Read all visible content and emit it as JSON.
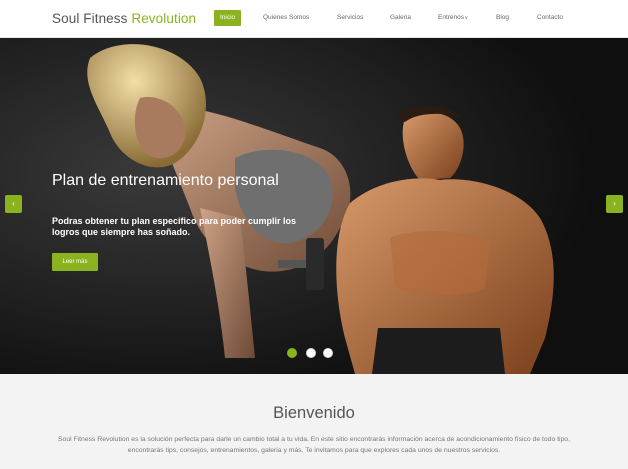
{
  "brand": {
    "name_main": "Soul Fitness ",
    "name_accent": "Revolution"
  },
  "nav": {
    "items": [
      {
        "label": "Inicio",
        "active": true
      },
      {
        "label": "Quienes Somos"
      },
      {
        "label": "Servicios"
      },
      {
        "label": "Galeria"
      },
      {
        "label": "Entrenos",
        "caret": "v"
      },
      {
        "label": "Blog"
      },
      {
        "label": "Contacto"
      }
    ]
  },
  "hero": {
    "title": "Plan de entrenamiento personal",
    "subtitle": "Podras obtener tu plan especifico para poder cumplir los logros que siempre has soñado.",
    "button_label": "Leer más",
    "prev_arrow": "‹",
    "next_arrow": "›",
    "slides_total": 3,
    "active_slide": 1
  },
  "welcome": {
    "title": "Bienvenido",
    "text": "Soul Fitness Revolution es la solución perfecta para darle un cambio total a tu vida. En este sitio encontrarás información acerca de acondicionamiento físico de todo tipo, encontrarás tips, consejos, entrenamientos, galeria y más. Te invitamos para que explores cada unos de nuestros servicios."
  },
  "colors": {
    "accent": "#8ab31f",
    "text": "#555555",
    "hero_bg": "#151515",
    "welcome_bg": "#f3f3f3"
  }
}
